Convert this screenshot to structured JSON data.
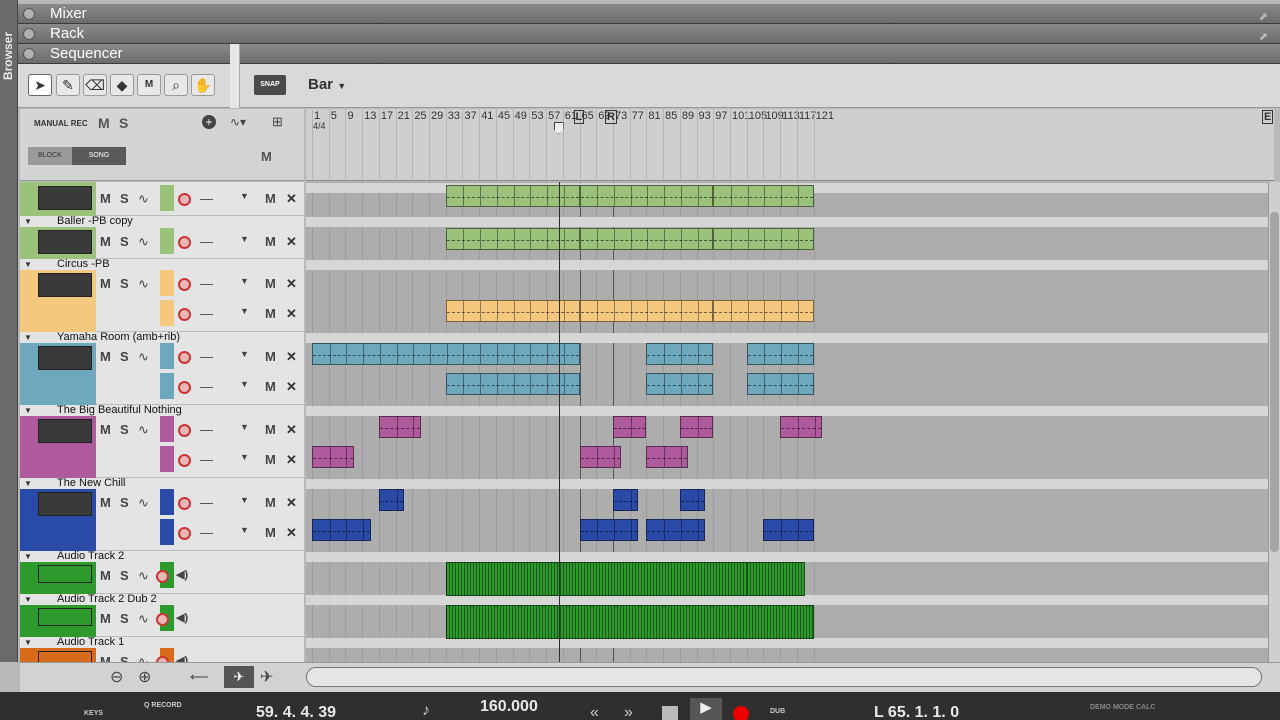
{
  "panels": {
    "mixer": "Mixer",
    "rack": "Rack",
    "sequencer": "Sequencer"
  },
  "browser_label": "Browser",
  "toolbar": {
    "snap": "SNAP",
    "grid_value": "Bar",
    "tools": [
      "arrow-icon",
      "pencil-icon",
      "eraser-icon",
      "razor-icon",
      "mute-tool-icon",
      "magnify-icon",
      "hand-icon"
    ]
  },
  "header": {
    "manual_rec": "MANUAL REC",
    "m": "M",
    "s": "S",
    "block": "BLOCK",
    "song": "SONG",
    "m2": "M"
  },
  "ruler": {
    "time_signature": "4/4",
    "bars": [
      "1",
      "5",
      "9",
      "13",
      "17",
      "21",
      "25",
      "29",
      "33",
      "37",
      "41",
      "45",
      "49",
      "53",
      "57",
      "61",
      "65",
      "69",
      "73",
      "77",
      "81",
      "85",
      "89",
      "93",
      "97",
      "101",
      "105",
      "109",
      "113",
      "117",
      "121"
    ],
    "left_locator": "L",
    "right_locator": "R",
    "end_marker": "E"
  },
  "tracks": [
    {
      "name": "",
      "color": "#9ac27a",
      "lanes": 2
    },
    {
      "name": "Baller  -PB copy",
      "color": "#9ac27a"
    },
    {
      "name": "Circus  -PB",
      "color": "#f5c880"
    },
    {
      "name": "Yamaha Room  (amb+rib)",
      "color": "#6ea8bc"
    },
    {
      "name": "The Big Beautiful Nothing",
      "color": "#b05a9e"
    },
    {
      "name": "The New Chill",
      "color": "#2a4aa8"
    },
    {
      "name": "Audio Track 2",
      "color": "#2e9a2e"
    },
    {
      "name": "Audio Track 2 Dub 2",
      "color": "#2e9a2e"
    },
    {
      "name": "Audio Track 1",
      "color": "#d86a1c"
    }
  ],
  "lane_buttons": {
    "m": "M",
    "s": "S",
    "x": "✕",
    "dash": "—"
  },
  "transport": {
    "keys": "KEYS",
    "q_record": "Q RECORD",
    "quantize": "1/8",
    "position": "59.  4.  4.  39",
    "tempo": "160.000",
    "dub": "DUB",
    "loop_pos": "L      65.   1.   1.     0",
    "demo": "DEMO MODE",
    "calc": "CALC"
  },
  "colors": {
    "green": "#9ac27a",
    "orange": "#f5c880",
    "teal": "#6ea8bc",
    "purple": "#b05a9e",
    "blue": "#2a4aa8",
    "audio": "#2e9a2e"
  }
}
